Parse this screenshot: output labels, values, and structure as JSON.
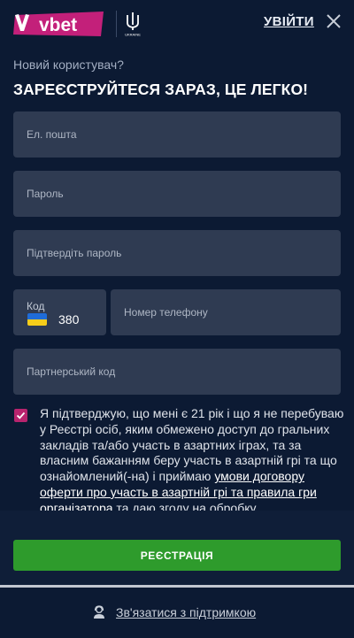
{
  "header": {
    "brand": "vbet",
    "trident_caption": "UKRAINE",
    "login_label": "УВІЙТИ",
    "brand_color": "#c3207a"
  },
  "intro": {
    "subtitle": "Новий користувач?",
    "title": "ЗАРЕЄСТРУЙТЕСЯ ЗАРАЗ, ЦЕ ЛЕГКО!"
  },
  "form": {
    "email_placeholder": "Ел. пошта",
    "password_placeholder": "Пароль",
    "confirm_password_placeholder": "Підтвердіть пароль",
    "code_label": "Код",
    "code_value": "380",
    "phone_placeholder": "Номер телефону",
    "partner_code_placeholder": "Партнерський код"
  },
  "consent": {
    "checked": true,
    "text_before": "Я підтверджую, що мені є 21 рік і що я не перебуваю у Реєстрі осіб, яким обмежено доступ до гральних закладів та/або участь в азартних іграх, та за власним бажанням беру участь в азартній грі та що ознайомлений(-на) і приймаю ",
    "link_text": "умови договору оферти про участь в азартній грі та правила гри організатора",
    "text_after": " та даю згоду на обробку"
  },
  "actions": {
    "register_label": "РЕЄСТРАЦІЯ",
    "register_color": "#2e9b2c"
  },
  "support": {
    "label": "Зв'язатися з підтримкою"
  }
}
